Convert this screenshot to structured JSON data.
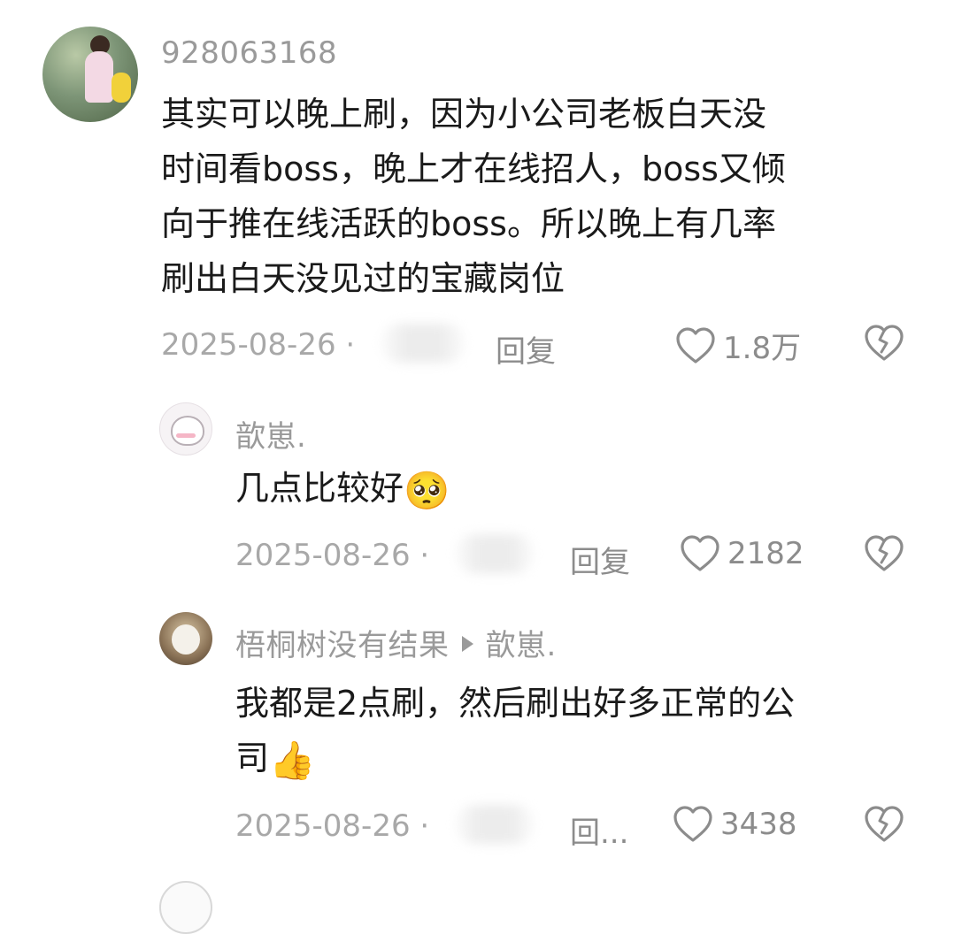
{
  "comments": [
    {
      "username": "928063168",
      "text": "其实可以晚上刷，因为小公司老板白天没\n时间看boss，晚上才在线招人，boss又倾\n向于推在线活跃的boss。所以晚上有几率\n刷出白天没见过的宝藏岗位",
      "date": "2025-08-26 ·",
      "reply_label": "回复",
      "likes": "1.8万"
    },
    {
      "username": "歆崽.",
      "text": "几点比较好",
      "emoji": "🥺",
      "date": "2025-08-26 ·",
      "reply_label": "回复",
      "likes": "2182"
    },
    {
      "username": "梧桐树没有结果",
      "reply_to": "歆崽.",
      "text": "我都是2点刷，然后刷出好多正常的公\n司",
      "emoji": "👍",
      "date": "2025-08-26 ·",
      "reply_label": "回...",
      "likes": "3438"
    }
  ],
  "icons": {
    "like": "heart-outline-icon",
    "dislike": "broken-heart-icon"
  },
  "colors": {
    "text": "#1a1a1a",
    "secondary": "#9a9a9a",
    "icon": "#8c8c8c"
  }
}
